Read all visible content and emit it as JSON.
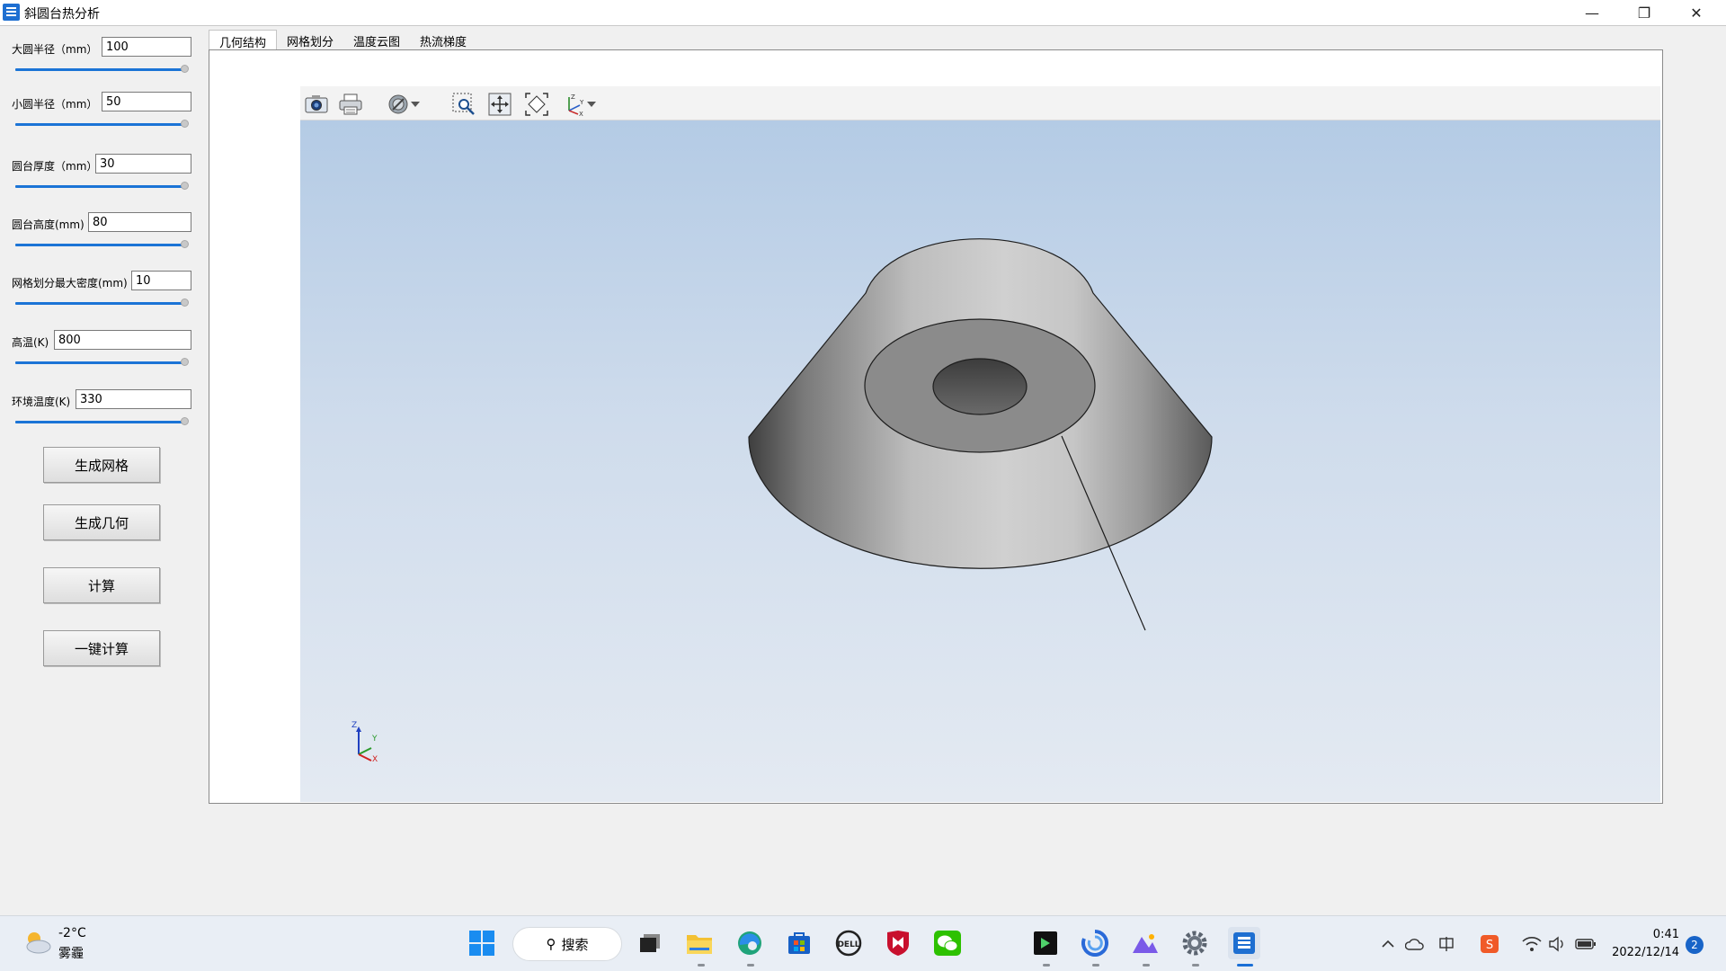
{
  "window": {
    "title": "斜圆台热分析",
    "min_label": "—",
    "max_label": "❐",
    "close_label": "✕"
  },
  "params": [
    {
      "label": "大圆半径（mm）",
      "value": "100"
    },
    {
      "label": "小圆半径（mm）",
      "value": "50"
    },
    {
      "label": "圆台厚度（mm）",
      "value": "30"
    },
    {
      "label": "圆台高度(mm)",
      "value": "80"
    },
    {
      "label": "网格划分最大密度(mm)",
      "value": "10"
    },
    {
      "label": "高温(K)",
      "value": "800"
    },
    {
      "label": "环境温度(K)",
      "value": "330"
    }
  ],
  "buttons": {
    "generate_mesh": "生成网格",
    "generate_geometry": "生成几何",
    "compute": "计算",
    "one_click_compute": "一键计算"
  },
  "tabs": [
    "几何结构",
    "网格划分",
    "温度云图",
    "热流梯度"
  ],
  "active_tab": 0,
  "viewer": {
    "toolbar_icons": [
      "camera-icon",
      "print-icon",
      "display-mode-icon",
      "zoom-box-icon",
      "pan-icon",
      "fit-all-icon",
      "axes-view-icon"
    ],
    "axes_labels": {
      "z": "Z",
      "y": "Y",
      "x": "X"
    }
  },
  "taskbar": {
    "weather_temp": "-2°C",
    "weather_desc": "雾霾",
    "search_label": "搜索",
    "clock_time": "0:41",
    "clock_date": "2022/12/14",
    "notification_count": "2"
  },
  "colors": {
    "accent": "#1b74d6",
    "viewport_top": "#b4cbe5",
    "viewport_bottom": "#e4eaf2"
  }
}
